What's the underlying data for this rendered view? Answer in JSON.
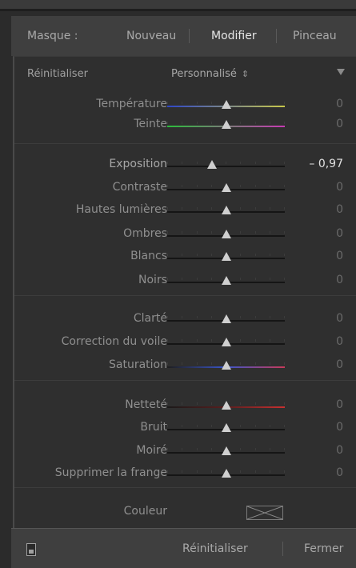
{
  "header": {
    "masque_label": "Masque :",
    "tabs": [
      {
        "label": "Nouveau",
        "active": false
      },
      {
        "label": "Modifier",
        "active": true
      },
      {
        "label": "Pinceau",
        "active": false
      }
    ]
  },
  "panel": {
    "reset_label": "Réinitialiser",
    "preset_label": "Personnalisé",
    "preset_arrows": "⇕"
  },
  "sliders": [
    {
      "label": "Température",
      "value": "0",
      "position": 0.5,
      "gradient": [
        "#2e46c8",
        "#c8c84a"
      ],
      "group": 1
    },
    {
      "label": "Teinte",
      "value": "0",
      "position": 0.5,
      "gradient": [
        "#2bbd3b",
        "#c83ab4"
      ],
      "group": 1
    },
    {
      "label": "Exposition",
      "value": "– 0,97",
      "position": 0.38,
      "bright": true,
      "group": 2
    },
    {
      "label": "Contraste",
      "value": "0",
      "position": 0.5,
      "group": 2
    },
    {
      "label": "Hautes lumières",
      "value": "0",
      "position": 0.5,
      "group": 2
    },
    {
      "label": "Ombres",
      "value": "0",
      "position": 0.5,
      "group": 2
    },
    {
      "label": "Blancs",
      "value": "0",
      "position": 0.5,
      "group": 2
    },
    {
      "label": "Noirs",
      "value": "0",
      "position": 0.5,
      "group": 2
    },
    {
      "label": "Clarté",
      "value": "0",
      "position": 0.5,
      "group": 3
    },
    {
      "label": "Correction du voile",
      "value": "0",
      "position": 0.5,
      "group": 3
    },
    {
      "label": "Saturation",
      "value": "0",
      "position": 0.5,
      "gradient": [
        "#1e1e1e",
        "#3a55c8",
        "#c83a5a"
      ],
      "group": 3
    },
    {
      "label": "Netteté",
      "value": "0",
      "position": 0.5,
      "gradient": [
        "#1a1a1a",
        "#5a1e1e",
        "#c83030"
      ],
      "group": 4
    },
    {
      "label": "Bruit",
      "value": "0",
      "position": 0.5,
      "group": 4
    },
    {
      "label": "Moiré",
      "value": "0",
      "position": 0.5,
      "group": 4
    },
    {
      "label": "Supprimer la frange",
      "value": "0",
      "position": 0.5,
      "group": 4
    }
  ],
  "couleur": {
    "label": "Couleur"
  },
  "footer": {
    "reset_label": "Réinitialiser",
    "close_label": "Fermer"
  },
  "colors": {
    "panel_bg": "#2f2f2f",
    "header_bg": "#3f3f3f",
    "knob": "#cfcfcf"
  }
}
